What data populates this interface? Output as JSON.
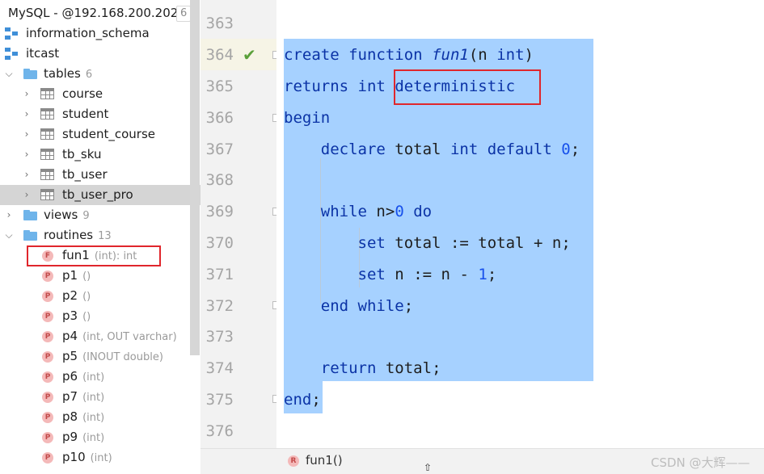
{
  "sidebar": {
    "connection": {
      "label": "MySQL - @192.168.200.202",
      "count": "6"
    },
    "schemas": [
      {
        "name": "information_schema"
      },
      {
        "name": "itcast"
      }
    ],
    "tables_folder": {
      "label": "tables",
      "count": "6"
    },
    "tables": [
      "course",
      "student",
      "student_course",
      "tb_sku",
      "tb_user",
      "tb_user_pro"
    ],
    "views_folder": {
      "label": "views",
      "count": "9"
    },
    "routines_folder": {
      "label": "routines",
      "count": "13"
    },
    "routines": [
      {
        "badge": "F",
        "name": "fun1",
        "sig": "(int): int"
      },
      {
        "badge": "P",
        "name": "p1",
        "sig": "()"
      },
      {
        "badge": "P",
        "name": "p2",
        "sig": "()"
      },
      {
        "badge": "P",
        "name": "p3",
        "sig": "()"
      },
      {
        "badge": "P",
        "name": "p4",
        "sig": "(int, OUT varchar)"
      },
      {
        "badge": "P",
        "name": "p5",
        "sig": "(INOUT double)"
      },
      {
        "badge": "P",
        "name": "p6",
        "sig": "(int)"
      },
      {
        "badge": "P",
        "name": "p7",
        "sig": "(int)"
      },
      {
        "badge": "P",
        "name": "p8",
        "sig": "(int)"
      },
      {
        "badge": "P",
        "name": "p9",
        "sig": "(int)"
      },
      {
        "badge": "P",
        "name": "p10",
        "sig": "(int)"
      }
    ]
  },
  "editor": {
    "line_numbers": [
      "363",
      "364",
      "365",
      "366",
      "367",
      "368",
      "369",
      "370",
      "371",
      "372",
      "373",
      "374",
      "375",
      "376"
    ],
    "tokens": {
      "create": "create",
      "function": "function",
      "fname": "fun1",
      "paren_open": "(",
      "param_n": "n",
      "int": "int",
      "paren_close": ")",
      "returns": "returns",
      "deterministic": "deterministic",
      "begin": "begin",
      "declare": "declare",
      "total": "total",
      "default": "default",
      "zero": "0",
      "semicolon": ";",
      "while": "while",
      "n": "n",
      "gt": ">",
      "do": "do",
      "set": "set",
      "assign": ":=",
      "plus": "+",
      "minus": "-",
      "one": "1",
      "end": "end",
      "return": "return"
    }
  },
  "bottom_bar": {
    "badge": "R",
    "breadcrumb": "fun1()",
    "watermark": "CSDN @大辉——"
  },
  "colors": {
    "selection": "#a6d1ff",
    "keyword": "#0b33a6",
    "number": "#1750eb",
    "highlight_box": "#e0262c",
    "check": "#5aa03a"
  }
}
